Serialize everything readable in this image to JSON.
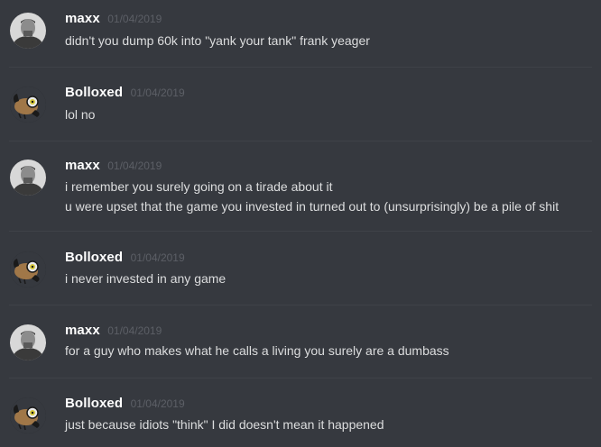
{
  "messages": [
    {
      "author": "maxx",
      "timestamp": "01/04/2019",
      "avatar_icon": "grayscale-portrait-avatar",
      "lines": [
        "didn't you dump 60k into \"yank your tank\" frank yeager"
      ]
    },
    {
      "author": "Bolloxed",
      "timestamp": "01/04/2019",
      "avatar_icon": "cartoon-bird-avatar",
      "lines": [
        "lol no"
      ]
    },
    {
      "author": "maxx",
      "timestamp": "01/04/2019",
      "avatar_icon": "grayscale-portrait-avatar",
      "lines": [
        "i remember you surely going on a tirade about it",
        "u were upset that the game you invested in turned out to (unsurprisingly) be a pile of shit"
      ]
    },
    {
      "author": "Bolloxed",
      "timestamp": "01/04/2019",
      "avatar_icon": "cartoon-bird-avatar",
      "lines": [
        "i never invested in any game"
      ]
    },
    {
      "author": "maxx",
      "timestamp": "01/04/2019",
      "avatar_icon": "grayscale-portrait-avatar",
      "lines": [
        "for a guy who makes what he calls a living you surely are a dumbass"
      ]
    },
    {
      "author": "Bolloxed",
      "timestamp": "01/04/2019",
      "avatar_icon": "cartoon-bird-avatar",
      "lines": [
        "just because idiots \"think\" I did doesn't mean it happened"
      ]
    }
  ],
  "colors": {
    "background": "#36393f",
    "username": "#ffffff",
    "message_text": "#dcddde",
    "timestamp": "#5c5f66",
    "divider": "#3f4248"
  }
}
